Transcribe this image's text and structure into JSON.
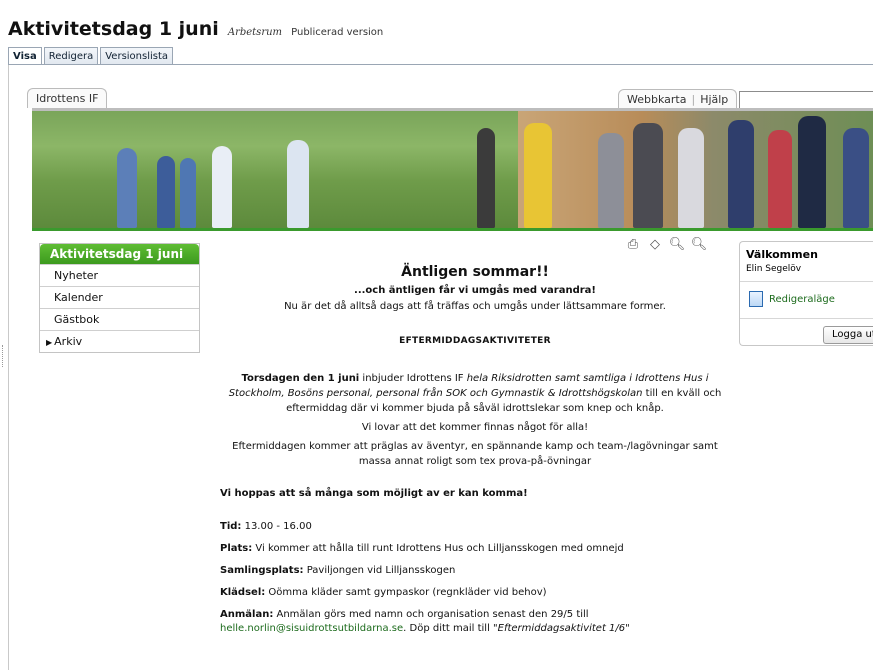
{
  "editor": {
    "page_title": "Aktivitetsdag 1 juni",
    "workspace": "Arbetsrum",
    "version_status": "Publicerad version",
    "tabs": [
      {
        "label": "Visa"
      },
      {
        "label": "Redigera"
      },
      {
        "label": "Versionslista"
      }
    ]
  },
  "site": {
    "org_tab": "Idrottens IF",
    "sitemap_link": "Webbkarta",
    "help_link": "Hjälp",
    "search_value": ""
  },
  "nav": {
    "heading": "Aktivitetsdag 1 juni",
    "items": [
      {
        "label": "Nyheter"
      },
      {
        "label": "Kalender"
      },
      {
        "label": "Gästbok"
      },
      {
        "label": "Arkiv"
      }
    ]
  },
  "toolbar_icons": [
    "print-icon",
    "tag-icon",
    "zoom-in-icon",
    "zoom-out-icon"
  ],
  "content": {
    "title": "Äntligen sommar!!",
    "subtitle": "...och äntligen får vi umgås med varandra!",
    "intro": "Nu är det då alltså dags att få träffas och umgås under lättsammare former.",
    "section_heading": "EFTERMIDDAGSAKTIVITETER",
    "main_bold": "Torsdagen den 1 juni",
    "main_text1": " inbjuder Idrottens IF ",
    "main_italic": "hela Riksidrotten samt samtliga i Idrottens Hus i Stockholm, Bosöns personal, personal från SOK och Gymnastik & Idrottshögskolan",
    "main_text2": " till en kväll och eftermiddag där vi kommer bjuda på såväl idrottslekar som knep och knåp.",
    "promise": "Vi lovar att det kommer finnas något för alla!",
    "afternoon": "Eftermiddagen kommer att präglas av äventyr, en spännande kamp och team-/lagövningar samt massa annat roligt som tex prova-på-övningar",
    "hope": "Vi hoppas att så många som möjligt av er kan komma!",
    "details": {
      "time_label": "Tid:",
      "time_value": " 13.00 - 16.00",
      "place_label": "Plats:",
      "place_value": " Vi kommer att hålla till runt Idrottens Hus och Lilljansskogen med omnejd",
      "gather_label": "Samlingsplats:",
      "gather_value": " Paviljongen vid Lilljansskogen",
      "dress_label": "Klädsel:",
      "dress_value": " Oömma kläder samt gympaskor (regnkläder vid behov)",
      "signup_label": "Anmälan:",
      "signup_value": " Anmälan görs med namn och organisation senast den 29/5 till",
      "email": "helle.norlin@sisuidrottsutbildarna.se",
      "signup_tail": ". Döp ditt mail till ",
      "mail_subject": "\"Eftermiddagsaktivitet 1/6\""
    }
  },
  "welcome": {
    "title": "Välkommen",
    "user": "Elin Segelöv",
    "edit_mode": "Redigeraläge",
    "logout": "Logga ut"
  },
  "colors": {
    "nav_green": "#4caf2a",
    "link_green": "#1d6b1d",
    "banner_border": "#3a9a2d"
  }
}
